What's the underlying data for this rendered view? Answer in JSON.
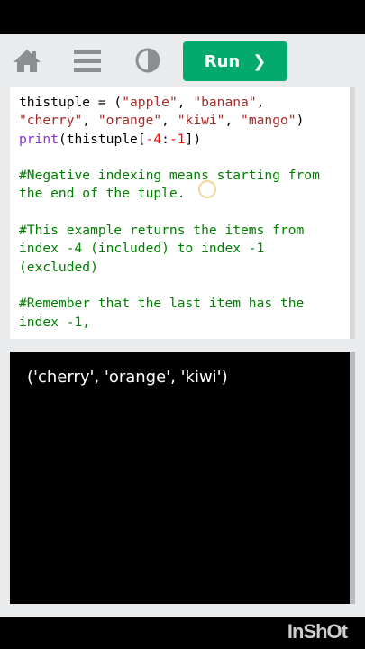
{
  "toolbar": {
    "icons": [
      "home-icon",
      "menu-icon",
      "contrast-icon"
    ],
    "run_label": "Run",
    "run_chevron": "❯",
    "run_color": "#04aa6d"
  },
  "editor": {
    "lines": [
      [
        {
          "t": "thistuple = (",
          "c": "plain"
        },
        {
          "t": "\"apple\"",
          "c": "str"
        },
        {
          "t": ", ",
          "c": "plain"
        },
        {
          "t": "\"banana\"",
          "c": "str"
        },
        {
          "t": ",",
          "c": "plain"
        }
      ],
      [
        {
          "t": "\"cherry\"",
          "c": "str"
        },
        {
          "t": ", ",
          "c": "plain"
        },
        {
          "t": "\"orange\"",
          "c": "str"
        },
        {
          "t": ", ",
          "c": "plain"
        },
        {
          "t": "\"kiwi\"",
          "c": "str"
        },
        {
          "t": ", ",
          "c": "plain"
        },
        {
          "t": "\"mango\"",
          "c": "str"
        },
        {
          "t": ")",
          "c": "plain"
        }
      ],
      [
        {
          "t": "print",
          "c": "fn"
        },
        {
          "t": "(thistuple[",
          "c": "plain"
        },
        {
          "t": "-4",
          "c": "num"
        },
        {
          "t": ":",
          "c": "plain"
        },
        {
          "t": "-1",
          "c": "num"
        },
        {
          "t": "])",
          "c": "plain"
        }
      ],
      [],
      [
        {
          "t": "#Negative indexing means starting from",
          "c": "com"
        }
      ],
      [
        {
          "t": "the end of the tuple.",
          "c": "com"
        }
      ],
      [],
      [
        {
          "t": "#This example returns the items from",
          "c": "com"
        }
      ],
      [
        {
          "t": "index -4 (included) to index -1",
          "c": "com"
        }
      ],
      [
        {
          "t": "(excluded)",
          "c": "com"
        }
      ],
      [],
      [
        {
          "t": "#Remember that the last item has the",
          "c": "com"
        }
      ],
      [
        {
          "t": "index -1,",
          "c": "com"
        }
      ]
    ]
  },
  "output": {
    "text": "('cherry', 'orange', 'kiwi')"
  },
  "watermark": "InShOt"
}
